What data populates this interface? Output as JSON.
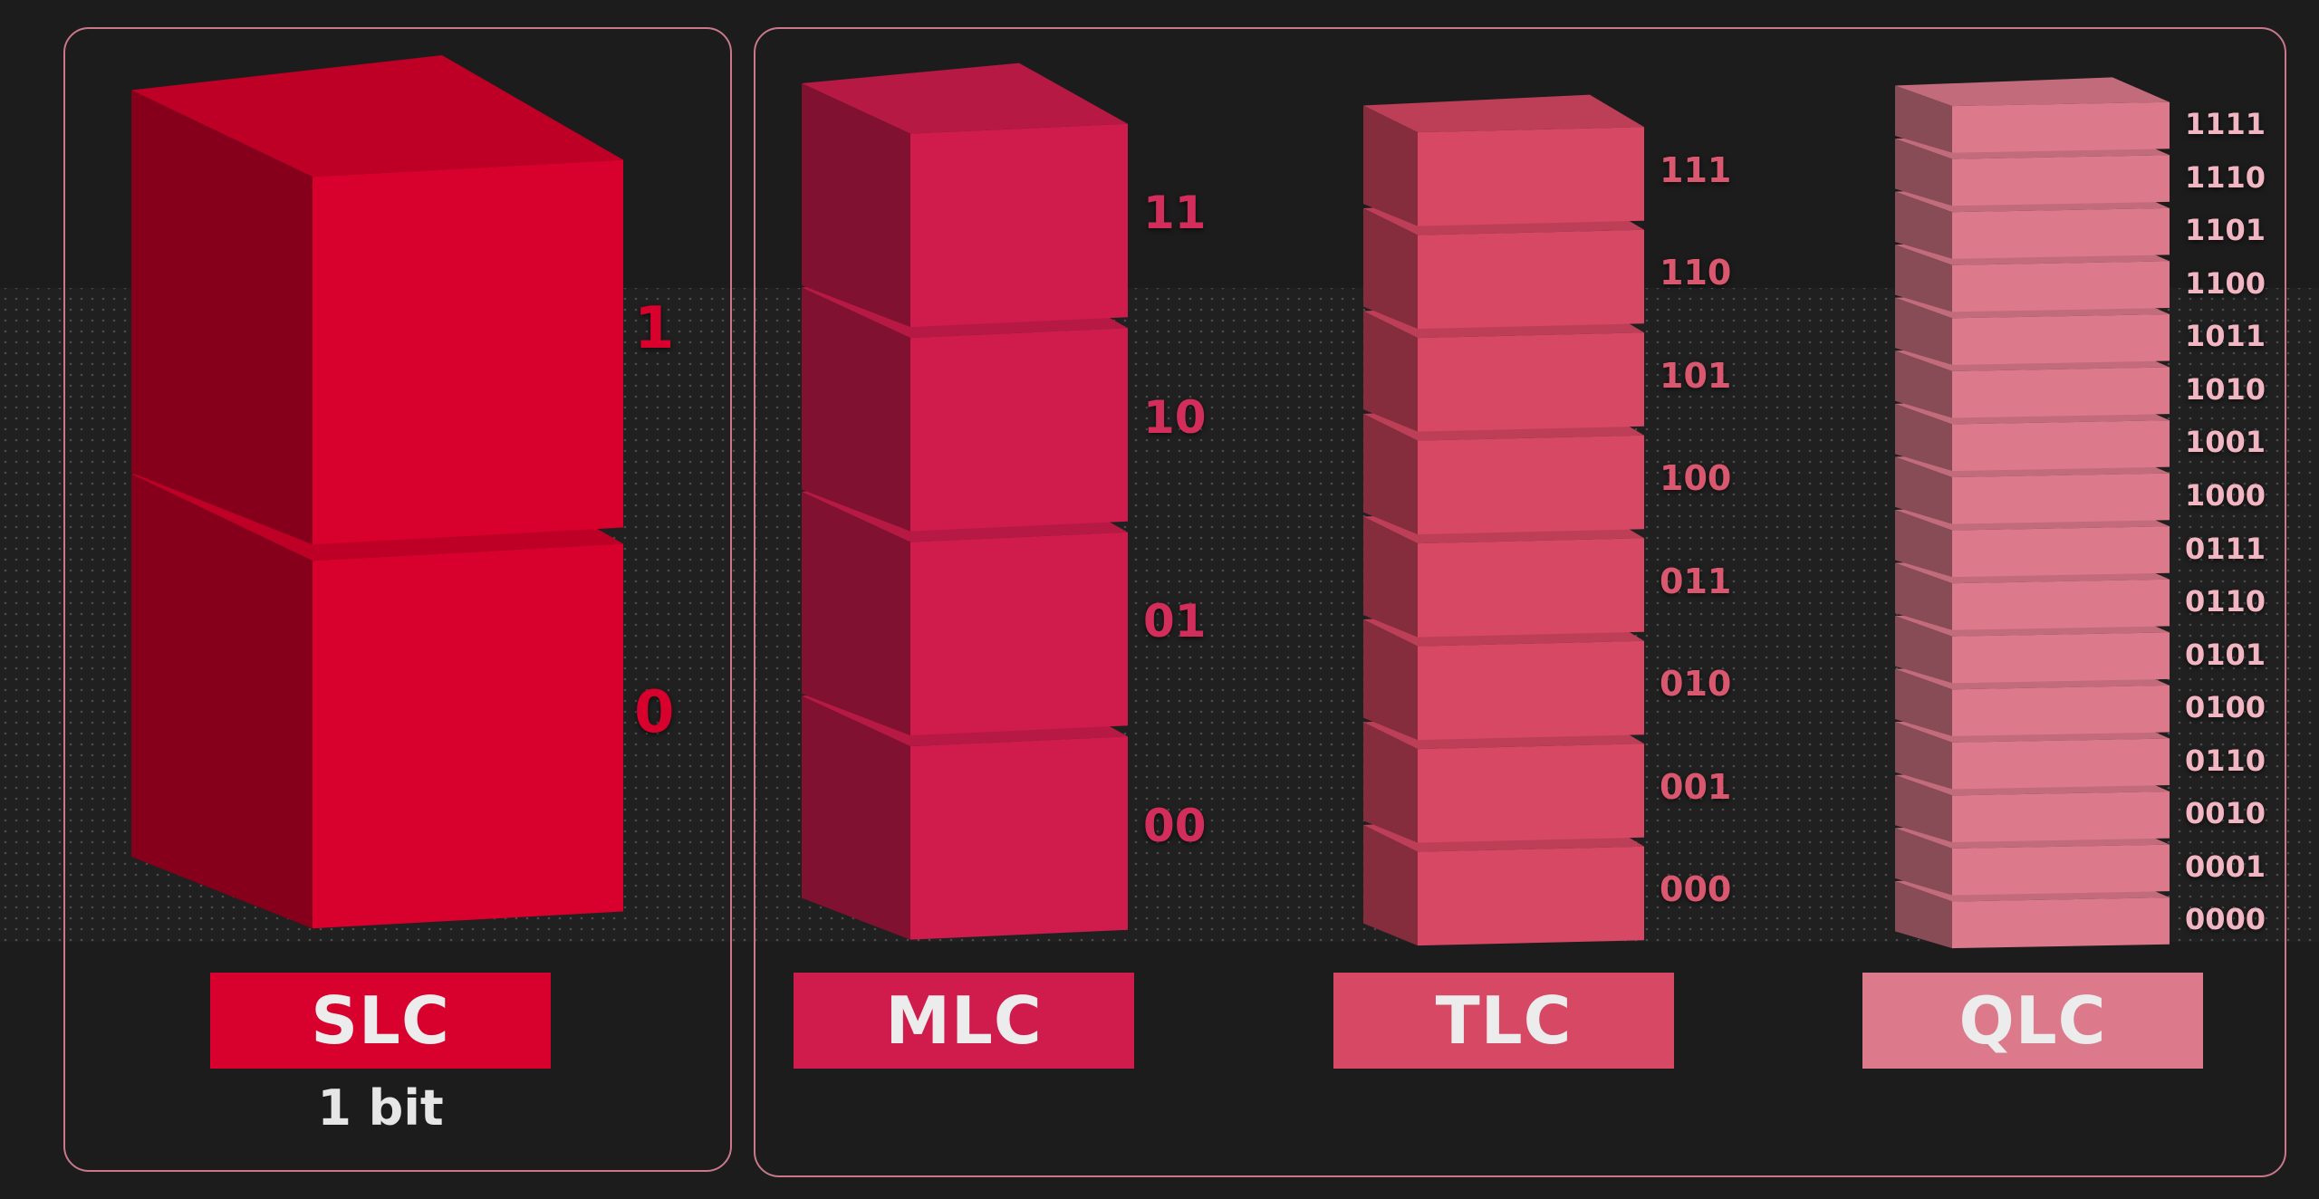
{
  "colors": {
    "background": "#1c1c1c",
    "panel_border": "#c8788a",
    "slc": "#d8002c",
    "mlc": "#cf1c4d",
    "tlc": "#d64863",
    "qlc": "#dc7a8c"
  },
  "cells": [
    {
      "name": "SLC",
      "caption": "1 bit",
      "levels": [
        "1",
        "0"
      ]
    },
    {
      "name": "MLC",
      "levels": [
        "11",
        "10",
        "01",
        "00"
      ]
    },
    {
      "name": "TLC",
      "levels": [
        "111",
        "110",
        "101",
        "100",
        "011",
        "010",
        "001",
        "000"
      ]
    },
    {
      "name": "QLC",
      "levels": [
        "1111",
        "1110",
        "1101",
        "1100",
        "1011",
        "1010",
        "1001",
        "1000",
        "0111",
        "0110",
        "0101",
        "0100",
        "0110",
        "0010",
        "0001",
        "0000"
      ]
    }
  ]
}
